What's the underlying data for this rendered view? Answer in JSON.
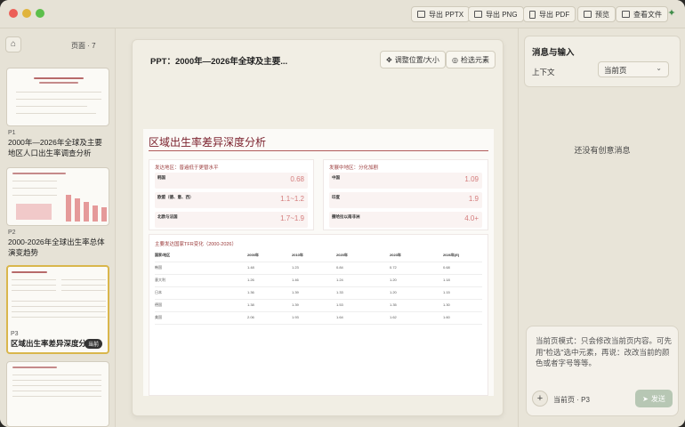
{
  "toolbar": {
    "export_pptx": "导出 PPTX",
    "export_png": "导出 PNG",
    "export_pdf": "导出 PDF",
    "preview": "预览",
    "view_file": "查看文件"
  },
  "sidebar": {
    "page_count": "页面 · 7",
    "pages": [
      {
        "num": "P1",
        "label": "2000年—2026年全球及主要地区人口出生率调查分析"
      },
      {
        "num": "P2",
        "label": "2000-2026年全球出生率总体演变趋势"
      },
      {
        "num": "P3",
        "label": "区域出生率差异深度分析",
        "badge": "当前"
      }
    ]
  },
  "editor": {
    "title": "PPT：2000年—2026年全球及主要...",
    "adjust_label": "调整位置/大小",
    "select_label": "检选元素"
  },
  "slide": {
    "title": "区域出生率差异深度分析",
    "developed": {
      "heading": "发达地区：普遍低于更替水平",
      "rows": [
        {
          "label": "韩国",
          "value": "0.68"
        },
        {
          "label": "欧盟（德、意、西）",
          "value": "1.1~1.2"
        },
        {
          "label": "北欧与法国",
          "value": "1.7~1.9"
        }
      ]
    },
    "developing": {
      "heading": "发展中地区：分化加剧",
      "rows": [
        {
          "label": "中国",
          "value": "1.09"
        },
        {
          "label": "印度",
          "value": "1.9"
        },
        {
          "label": "撒哈拉以南非洲",
          "value": "4.0+"
        }
      ]
    },
    "table": {
      "heading": "主要发达国家TFR变化（2000-2026）",
      "headers": [
        "国家/地区",
        "2000年",
        "2010年",
        "2020年",
        "2023年",
        "2026年(E)"
      ],
      "rows": [
        [
          "韩国",
          "1.48",
          "1.23",
          "0.84",
          "0.72",
          "0.68"
        ],
        [
          "意大利",
          "1.26",
          "1.46",
          "1.24",
          "1.20",
          "1.18"
        ],
        [
          "日本",
          "1.36",
          "1.39",
          "1.33",
          "1.20",
          "1.15"
        ],
        [
          "德国",
          "1.38",
          "1.39",
          "1.53",
          "1.35",
          "1.30"
        ],
        [
          "美国",
          "2.06",
          "1.93",
          "1.64",
          "1.62",
          "1.60"
        ]
      ]
    }
  },
  "right_panel": {
    "title": "消息与输入",
    "context_label": "上下文",
    "context_value": "当前页",
    "empty_message": "还没有创意消息",
    "compose_placeholder": "当前页模式：只会修改当前页内容。可先用\"检选\"选中元素，再说：改改当前的颜色或者字号等等。",
    "current_page": "当前页 · P3",
    "send_label": "发送"
  },
  "colors": {
    "accent": "#7a1f2b",
    "bar": "#e59a9a",
    "active_border": "#d9b64c"
  }
}
